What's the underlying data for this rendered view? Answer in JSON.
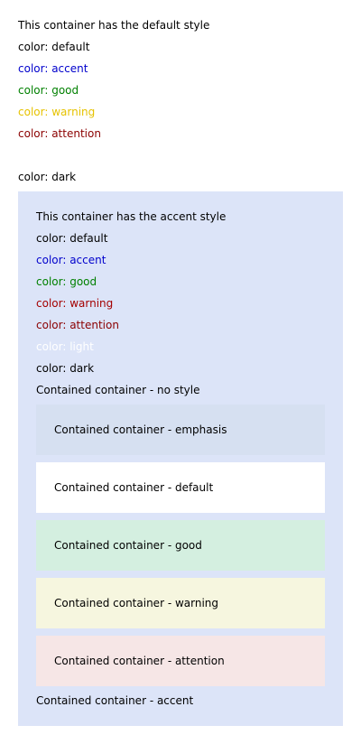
{
  "colors": {
    "page_bg": "#ffffff",
    "text_default": "#000000",
    "text_accent": "#0000cc",
    "text_good": "#008000",
    "text_warning_default": "#e6c200",
    "text_warning_on_accent": "#a40000",
    "text_attention": "#8b0000",
    "text_light": "#ffffff",
    "text_dark": "#000000",
    "accent_bg": "#dce4f8",
    "emphasis_bg": "#d6e0f1",
    "default_bg": "#ffffff",
    "good_bg": "#d4efe0",
    "warning_bg": "#f6f6df",
    "attention_bg": "#f6e6e6"
  },
  "default_section": {
    "heading": "This container has the default style",
    "items": {
      "default": "color: default",
      "accent": "color: accent",
      "good": "color: good",
      "warning": "color: warning",
      "attention": "color: attention",
      "dark": "color: dark"
    }
  },
  "accent_section": {
    "heading": "This container has the accent style",
    "items": {
      "default": "color: default",
      "accent": "color: accent",
      "good": "color: good",
      "warning": "color: warning",
      "attention": "color: attention",
      "light": "color: light",
      "dark": "color: dark"
    },
    "no_style_label": "Contained container - no style",
    "nested": {
      "emphasis": "Contained container - emphasis",
      "default": "Contained container - default",
      "good": "Contained container - good",
      "warning": "Contained container - warning",
      "attention": "Contained container - attention"
    },
    "accent_label": "Contained container - accent"
  }
}
